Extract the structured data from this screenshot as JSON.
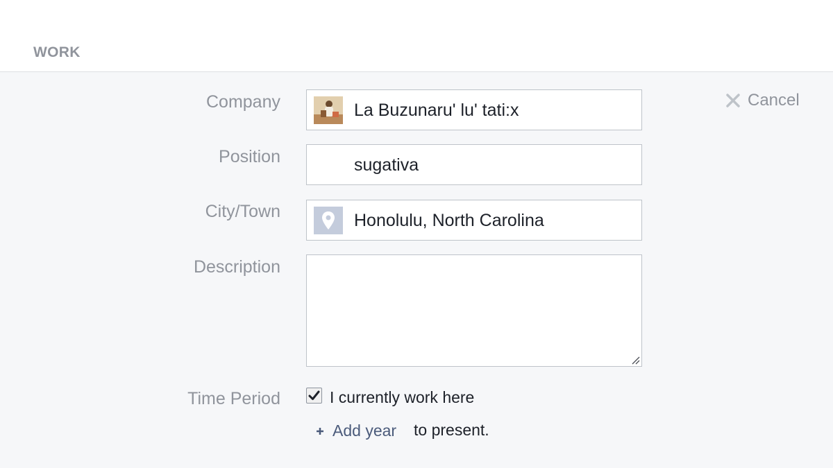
{
  "section": {
    "title": "WORK"
  },
  "cancel": {
    "label": "Cancel",
    "icon": "close-icon"
  },
  "form": {
    "company": {
      "label": "Company",
      "value": "La Buzunaru' lu' tati:x",
      "icon": "company-thumbnail"
    },
    "position": {
      "label": "Position",
      "value": "sugativa"
    },
    "city": {
      "label": "City/Town",
      "value": "Honolulu, North Carolina",
      "icon": "map-pin-icon"
    },
    "description": {
      "label": "Description",
      "value": ""
    },
    "time_period": {
      "label": "Time Period",
      "current_checkbox_label": "I currently work here",
      "current_checked": true,
      "add_year_label": "Add year",
      "to_present": "to present."
    }
  },
  "colors": {
    "background": "#f6f7f9",
    "label": "#90949c",
    "text": "#1d2129",
    "border": "#bec3c9",
    "link": "#4b5b7b"
  }
}
